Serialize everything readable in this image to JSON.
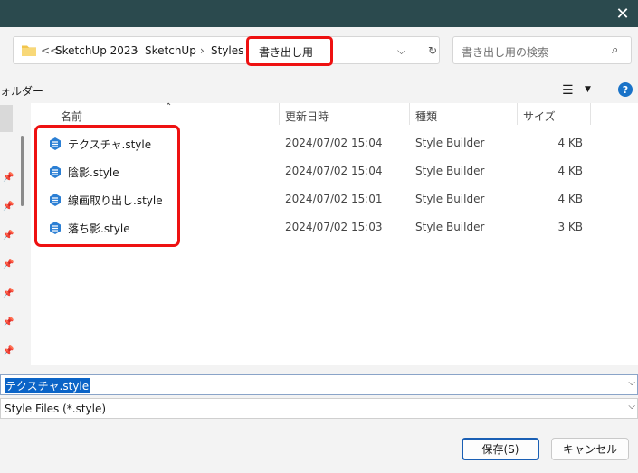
{
  "address": {
    "back_marker": "<<",
    "crumbs": [
      "SketchUp 2023",
      "SketchUp",
      "Styles",
      "書き出し用"
    ],
    "separator": "›"
  },
  "search": {
    "placeholder": "書き出し用の検索"
  },
  "toolbar": {
    "organize_label": "ォルダー"
  },
  "columns": {
    "name": "名前",
    "date": "更新日時",
    "type": "種類",
    "size": "サイズ"
  },
  "files": [
    {
      "name": "テクスチャ.style",
      "date": "2024/07/02 15:04",
      "type": "Style Builder",
      "size": "4 KB"
    },
    {
      "name": "陰影.style",
      "date": "2024/07/02 15:04",
      "type": "Style Builder",
      "size": "4 KB"
    },
    {
      "name": "線画取り出し.style",
      "date": "2024/07/02 15:01",
      "type": "Style Builder",
      "size": "4 KB"
    },
    {
      "name": "落ち影.style",
      "date": "2024/07/02 15:03",
      "type": "Style Builder",
      "size": "3 KB"
    }
  ],
  "filename": {
    "value": "テクスチャ.style"
  },
  "filetype": {
    "value": "Style Files (*.style)"
  },
  "buttons": {
    "save": "保存(S)",
    "cancel": "キャンセル"
  },
  "help": {
    "label": "?"
  },
  "colors": {
    "titlebar": "#2b4a4e",
    "highlight": "#ee1111",
    "accent": "#1a73c8"
  }
}
